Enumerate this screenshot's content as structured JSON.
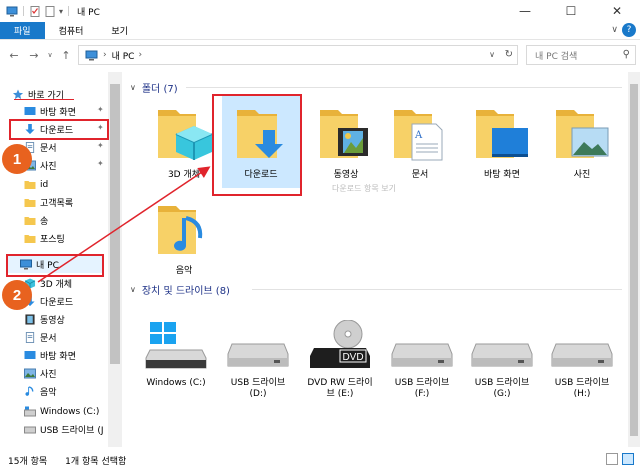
{
  "window": {
    "title": "내 PC",
    "minimize": "—",
    "maximize": "☐",
    "close": "✕"
  },
  "ribbon": {
    "tabs": [
      "파일",
      "컴퓨터",
      "보기"
    ],
    "expand": "∨",
    "help": "?"
  },
  "address": {
    "back": "←",
    "forward": "→",
    "dropdown": "∨",
    "up": "↑",
    "path_sep": "›",
    "path": "내 PC",
    "path_dropdown": "∨",
    "refresh": "↻"
  },
  "search": {
    "placeholder": "내 PC 검색",
    "icon": "⚲"
  },
  "nav": {
    "quick_access": "바로 가기",
    "items": [
      {
        "label": "바탕 화면",
        "icon": "desktop-icon",
        "pinned": true
      },
      {
        "label": "다운로드",
        "icon": "download-icon",
        "pinned": true
      },
      {
        "label": "문서",
        "icon": "document-icon",
        "pinned": true
      },
      {
        "label": "사진",
        "icon": "pictures-icon",
        "pinned": true
      },
      {
        "label": "id",
        "icon": "folder-icon",
        "pinned": false
      },
      {
        "label": "고객목록",
        "icon": "folder-icon",
        "pinned": false
      },
      {
        "label": "송",
        "icon": "folder-icon",
        "pinned": false
      },
      {
        "label": "포스팅",
        "icon": "folder-icon",
        "pinned": false
      }
    ],
    "this_pc": "내 PC",
    "pc_items": [
      {
        "label": "3D 개체",
        "icon": "3d-objects-icon"
      },
      {
        "label": "다운로드",
        "icon": "download-icon"
      },
      {
        "label": "동영상",
        "icon": "video-icon"
      },
      {
        "label": "문서",
        "icon": "document-icon"
      },
      {
        "label": "바탕 화면",
        "icon": "desktop-icon"
      },
      {
        "label": "사진",
        "icon": "pictures-icon"
      },
      {
        "label": "음악",
        "icon": "music-icon"
      },
      {
        "label": "Windows (C:)",
        "icon": "drive-icon"
      },
      {
        "label": "USB 드라이브 (J",
        "icon": "usb-drive-icon"
      }
    ],
    "pin_glyph": "📌"
  },
  "folders": {
    "heading": "폴더 (7)",
    "chevron": "∨",
    "items": [
      {
        "label": "3D 개체",
        "icon": "3d-objects-folder-icon"
      },
      {
        "label": "다운로드",
        "icon": "download-folder-icon"
      },
      {
        "label": "동영상",
        "icon": "video-folder-icon"
      },
      {
        "label": "문서",
        "icon": "document-folder-icon"
      },
      {
        "label": "바탕 화면",
        "icon": "desktop-folder-icon"
      },
      {
        "label": "사진",
        "icon": "pictures-folder-icon"
      },
      {
        "label": "음악",
        "icon": "music-folder-icon"
      }
    ],
    "tooltip": "다운로드 항목 보기"
  },
  "devices": {
    "heading": "장치 및 드라이브 (8)",
    "chevron": "∨",
    "items": [
      {
        "line1": "Windows (C:)",
        "line2": "",
        "icon": "windows-drive-icon"
      },
      {
        "line1": "USB 드라이브",
        "line2": "(D:)",
        "icon": "usb-drive-icon"
      },
      {
        "line1": "DVD RW 드라이",
        "line2": "브 (E:)",
        "icon": "dvd-drive-icon",
        "badge": "DVD"
      },
      {
        "line1": "USB 드라이브",
        "line2": "(F:)",
        "icon": "usb-drive-icon"
      },
      {
        "line1": "USB 드라이브",
        "line2": "(G:)",
        "icon": "usb-drive-icon"
      },
      {
        "line1": "USB 드라이브",
        "line2": "(H:)",
        "icon": "usb-drive-icon"
      }
    ]
  },
  "status": {
    "count": "15개 항목",
    "selected": "1개 항목 선택함"
  },
  "annotations": {
    "badge1": "1",
    "badge2": "2"
  },
  "colors": {
    "accent": "#1979ca",
    "annotation": "#e0242c",
    "badge": "#e8621f",
    "folder": "#f5c74e",
    "selected": "#cce8ff"
  }
}
